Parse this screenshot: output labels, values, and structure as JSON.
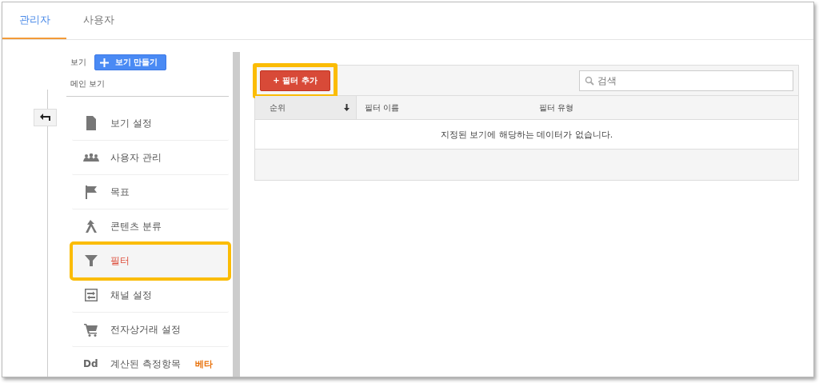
{
  "tabs": [
    {
      "label": "관리자",
      "selected": true
    },
    {
      "label": "사용자",
      "selected": false
    }
  ],
  "view_header": {
    "label": "보기",
    "create_button": "보기 만들기",
    "current_view": "메인 보기"
  },
  "nav_items": [
    {
      "kind": "document",
      "label": "보기 설정",
      "selected": false,
      "highlighted": false
    },
    {
      "kind": "people",
      "label": "사용자 관리",
      "selected": false,
      "highlighted": false
    },
    {
      "kind": "flag",
      "label": "목표",
      "selected": false,
      "highlighted": false
    },
    {
      "kind": "grouping",
      "label": "콘텐츠 분류",
      "selected": false,
      "highlighted": false
    },
    {
      "kind": "filter",
      "label": "필터",
      "selected": true,
      "highlighted": true
    },
    {
      "kind": "channel",
      "label": "채널 설정",
      "selected": false,
      "highlighted": false
    },
    {
      "kind": "cart",
      "label": "전자상거래 설정",
      "selected": false,
      "highlighted": false
    },
    {
      "kind": "text_icon",
      "icon_text": "Dd",
      "label": "계산된 측정항목",
      "badge": "베타",
      "selected": false,
      "highlighted": false
    }
  ],
  "add_filter_button": {
    "label": "+ 필터 추가",
    "highlighted": true
  },
  "search": {
    "placeholder": "검색"
  },
  "table": {
    "columns": [
      {
        "label": "순위",
        "sorted": true
      },
      {
        "label": "필터 이름",
        "sorted": false
      },
      {
        "label": "필터 유형",
        "sorted": false
      }
    ],
    "empty_message": "지정된 보기에 해당하는 데이터가 없습니다."
  }
}
